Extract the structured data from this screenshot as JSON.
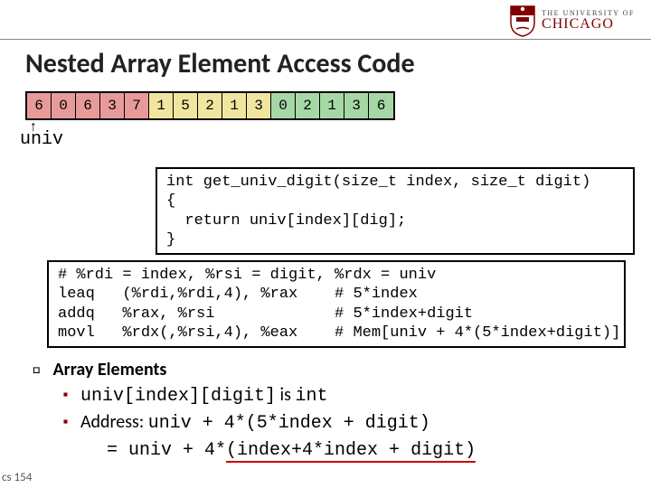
{
  "logo": {
    "top": "THE UNIVERSITY OF",
    "bottom": "CHICAGO"
  },
  "title": "Nested Array Element Access Code",
  "cells": [
    "6",
    "0",
    "6",
    "3",
    "7",
    "1",
    "5",
    "2",
    "1",
    "3",
    "0",
    "2",
    "1",
    "3",
    "6"
  ],
  "univ_label": "univ",
  "code1": {
    "l1": "int get_univ_digit(size_t index, size_t digit)",
    "l2": "{",
    "l3": "  return univ[index][dig];",
    "l4": "}"
  },
  "code2": {
    "l1": "# %rdi = index, %rsi = digit, %rdx = univ",
    "l2": "leaq   (%rdi,%rdi,4), %rax    # 5*index",
    "l3": "addq   %rax, %rsi             # 5*index+digit",
    "l4": "movl   %rdx(,%rsi,4), %eax    # Mem[univ + 4*(5*index+digit)]"
  },
  "bullets": {
    "h": "Array Elements",
    "b1a": "univ[index][digit]",
    "b1b": " is ",
    "b1c": "int",
    "b2a": "Address: ",
    "b2b": "univ + 4*(5*index + digit)",
    "b3a": "= univ + 4*",
    "b3b": "(index+4*index + digit)"
  },
  "footer": "cs 154"
}
